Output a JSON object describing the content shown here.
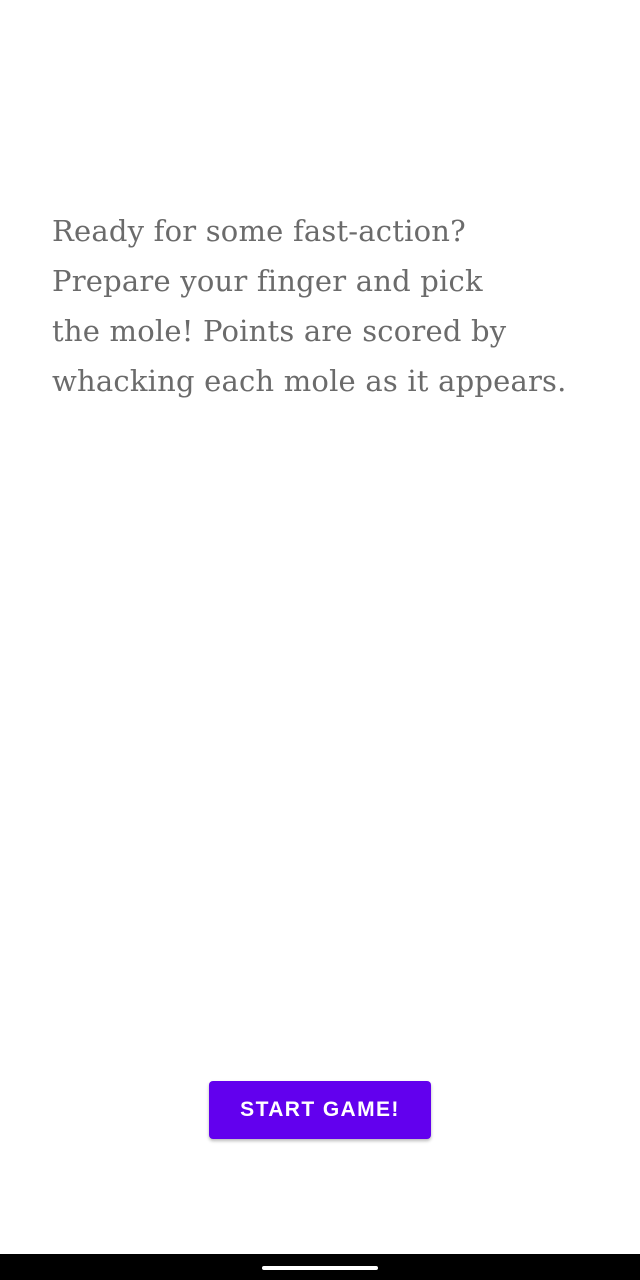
{
  "intro": {
    "lines": [
      "Ready for some fast-action?",
      "Prepare your finger and pick",
      "the mole! Points are scored by",
      "whacking each mole as it appears."
    ]
  },
  "start_button": {
    "label": "START GAME!"
  },
  "colors": {
    "background": "#ffffff",
    "text": "#6b6b6b",
    "button": "#6200ee",
    "button_text": "#ffffff",
    "nav_bar": "#000000"
  }
}
